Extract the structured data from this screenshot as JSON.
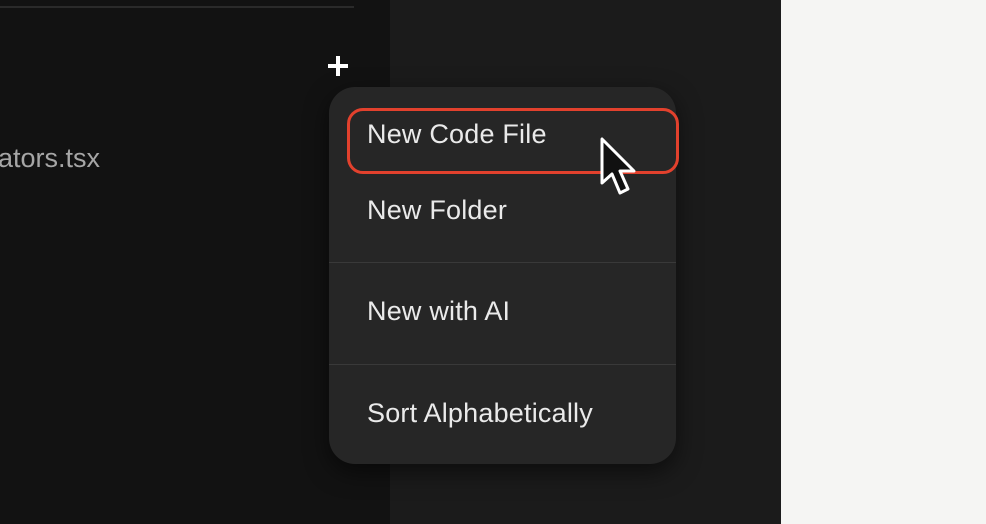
{
  "sidebar": {
    "add_icon": "plus-icon",
    "file_name": "ators.tsx"
  },
  "context_menu": {
    "items": [
      {
        "label": "New Code File",
        "highlighted": true
      },
      {
        "label": "New Folder"
      },
      {
        "label": "New with AI"
      },
      {
        "label": "Sort Alphabetically"
      }
    ]
  },
  "overlay": {
    "highlight_color": "#e2412d",
    "cursor_icon": "pointer-cursor-icon"
  }
}
